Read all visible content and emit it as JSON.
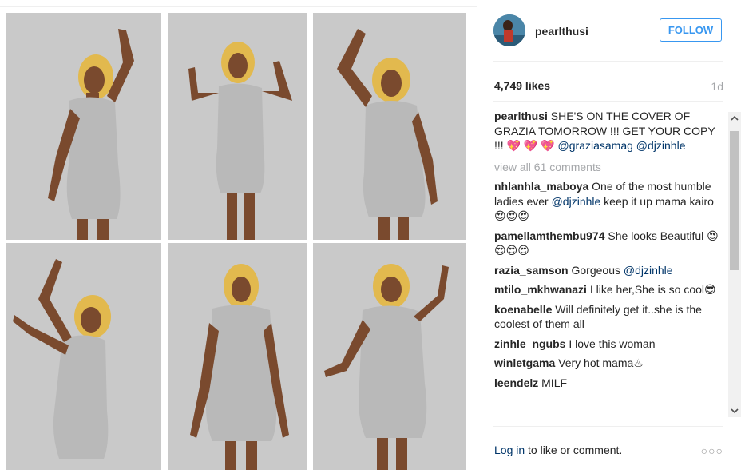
{
  "post": {
    "username": "pearlthusi",
    "follow_label": "FOLLOW",
    "likes": "4,749 likes",
    "age": "1d"
  },
  "caption": {
    "username": "pearlthusi",
    "text": "SHE'S ON THE COVER OF GRAZIA TOMORROW !!! GET YOUR COPY !!! 💖 💖 💖 ",
    "mention1": "@graziasamag",
    "mention2": "@djzinhle"
  },
  "view_all": "view all 61 comments",
  "comments": [
    {
      "user": "nhlanhla_maboya",
      "text_a": "One of the most humble ladies ever ",
      "mention": "@djzinhle",
      "text_b": " keep it up mama kairo 😍😍😍"
    },
    {
      "user": "pamellamthembu974",
      "text_a": "She looks Beautiful 😍😍😍😍",
      "mention": "",
      "text_b": ""
    },
    {
      "user": "razia_samson",
      "text_a": "Gorgeous ",
      "mention": "@djzinhle",
      "text_b": ""
    },
    {
      "user": "mtilo_mkhwanazi",
      "text_a": "I like her,She is so cool😎",
      "mention": "",
      "text_b": ""
    },
    {
      "user": "koenabelle",
      "text_a": "Will definitely get it..she is the coolest of them all",
      "mention": "",
      "text_b": ""
    },
    {
      "user": "zinhle_ngubs",
      "text_a": "I love this woman",
      "mention": "",
      "text_b": ""
    },
    {
      "user": "winletgama",
      "text_a": "Very hot mama♨",
      "mention": "",
      "text_b": ""
    },
    {
      "user": "leendelz",
      "text_a": "MILF",
      "mention": "",
      "text_b": ""
    }
  ],
  "footer": {
    "login_link": "Log in",
    "login_rest": " to like or comment.",
    "more": "○○○"
  },
  "icons": {
    "avatar": "avatar",
    "scroll_up": "chevron-up-icon",
    "scroll_down": "chevron-down-icon",
    "more": "more-options-icon"
  },
  "colors": {
    "accent": "#3897f0",
    "mention": "#003569",
    "muted": "#a5a7aa"
  }
}
